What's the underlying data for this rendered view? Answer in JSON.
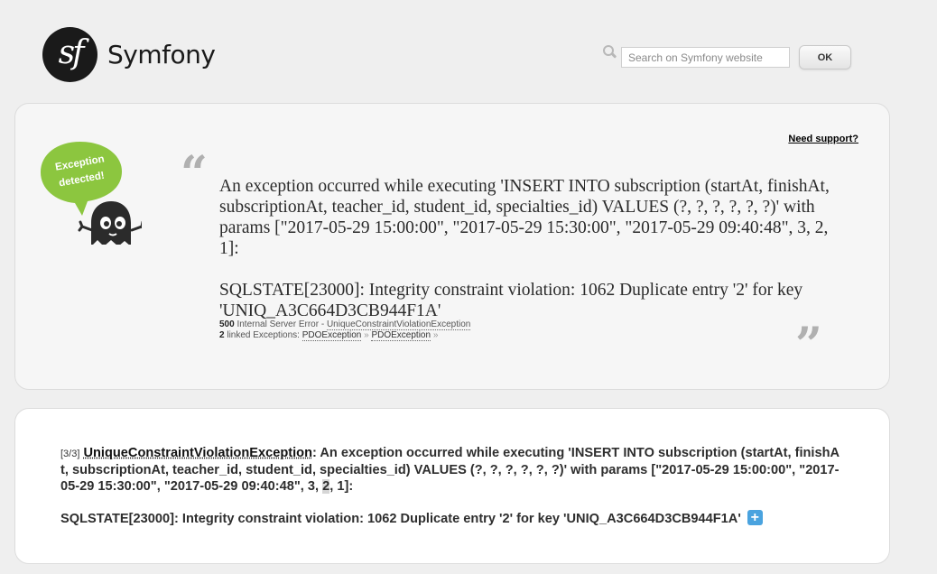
{
  "brand": {
    "logo_glyph": "sf",
    "name": "Symfony"
  },
  "search": {
    "placeholder": "Search on Symfony website",
    "value": "",
    "button_label": "OK"
  },
  "top_panel": {
    "need_support": "Need support?",
    "mascot_bubble": "Exception detected!",
    "quote_open": "“",
    "quote_close": "”",
    "message_line1": "An exception occurred while executing 'INSERT INTO subscription (startAt, finishAt, subscriptionAt, teacher_id, student_id, specialties_id) VALUES (?, ?, ?, ?, ?, ?)' with params [\"2017-05-29 15:00:00\", \"2017-05-29 15:30:00\", \"2017-05-29 09:40:48\", 3, 2, 1]:",
    "message_line2": "SQLSTATE[23000]: Integrity constraint violation: 1062 Duplicate entry '2' for key 'UNIQ_A3C664D3CB944F1A'",
    "status_code": "500",
    "status_text": "Internal Server Error",
    "status_sep": " - ",
    "exception_class": "UniqueConstraintViolationException",
    "linked_count": "2",
    "linked_label": "linked Exceptions:",
    "linked": [
      "PDOException",
      "PDOException"
    ],
    "linked_sep": "»"
  },
  "detail": {
    "counter": "[3/3]",
    "exception_name": "UniqueConstraintViolationException",
    "text_before_highlight": ": An exception occurred while executing 'INSERT INTO subscription (startAt, finishAt, subscriptionAt, teacher_id, student_id, specialties_id) VALUES (?, ?, ?, ?, ?, ?)' with params [\"2017-05-29 15:00:00\", \"2017-05-29 15:30:00\", \"2017-05-29 09:40:48\", 3, ",
    "highlight": "2",
    "text_after_highlight": ", 1]:",
    "sqlstate": "SQLSTATE[23000]: Integrity constraint violation: 1062 Duplicate entry '2' for key 'UNIQ_A3C664D3CB944F1A'",
    "expand_label": "+"
  },
  "colors": {
    "mascot_bubble": "#8cc63f",
    "mascot_body": "#2b2b2b",
    "expand_button": "#4aa3df"
  }
}
